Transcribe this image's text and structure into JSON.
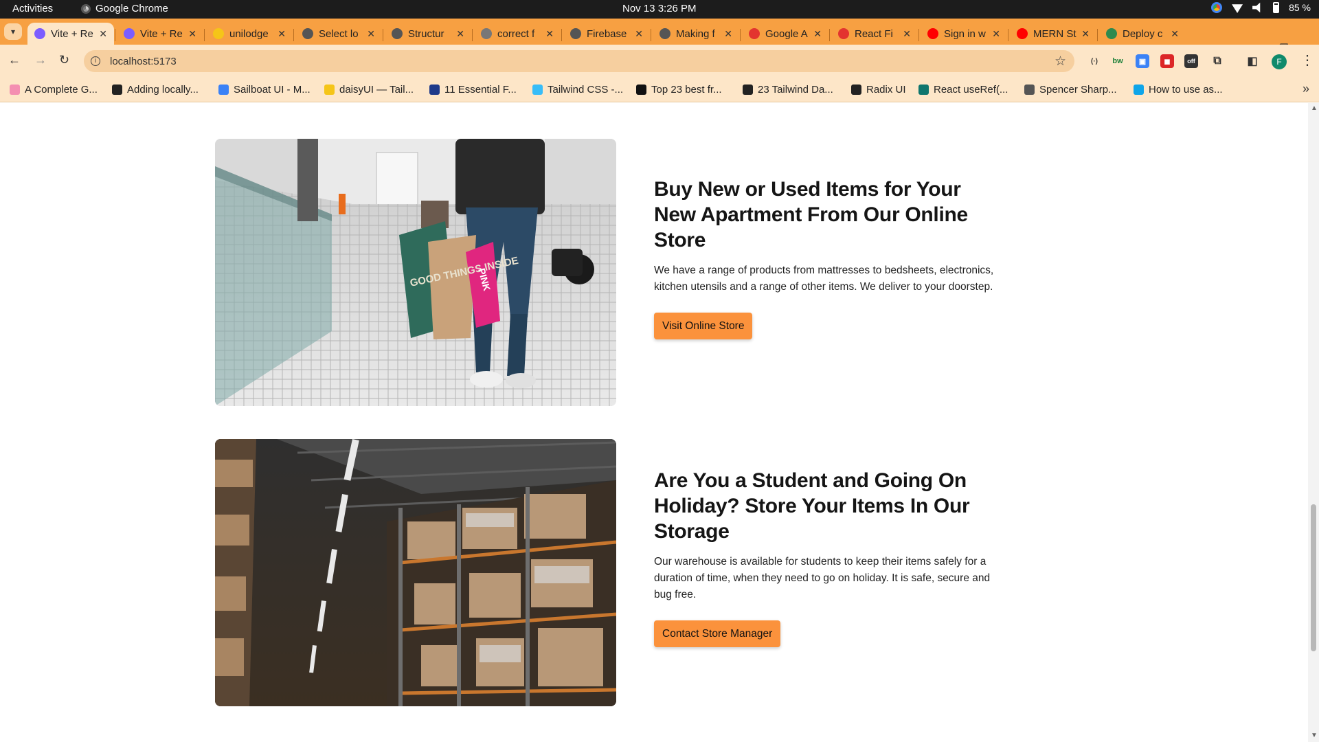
{
  "os": {
    "activities": "Activities",
    "app_name": "Google Chrome",
    "clock": "Nov 13  3:26 PM",
    "battery": "85 %"
  },
  "tabs": [
    {
      "title": "Vite + Re",
      "active": true,
      "fav_color": "#7c5cff"
    },
    {
      "title": "Vite + Re",
      "active": false,
      "fav_color": "#7c5cff"
    },
    {
      "title": "unilodge",
      "active": false,
      "fav_color": "#f5c518"
    },
    {
      "title": "Select lo",
      "active": false,
      "fav_color": "#555555"
    },
    {
      "title": "Structur",
      "active": false,
      "fav_color": "#555555"
    },
    {
      "title": "correct f",
      "active": false,
      "fav_color": "#777777"
    },
    {
      "title": "Firebase",
      "active": false,
      "fav_color": "#555555"
    },
    {
      "title": "Making f",
      "active": false,
      "fav_color": "#555555"
    },
    {
      "title": "Google A",
      "active": false,
      "fav_color": "#e3342f"
    },
    {
      "title": "React Fi",
      "active": false,
      "fav_color": "#e3342f"
    },
    {
      "title": "Sign in w",
      "active": false,
      "fav_color": "#ff0000"
    },
    {
      "title": "MERN St",
      "active": false,
      "fav_color": "#ff0000"
    },
    {
      "title": "Deploy c",
      "active": false,
      "fav_color": "#2d8a4e"
    }
  ],
  "address_bar": {
    "url": "localhost:5173"
  },
  "bookmarks": [
    {
      "label": "A Complete G...",
      "color": "#f48fb1"
    },
    {
      "label": "Adding locally...",
      "color": "#222222"
    },
    {
      "label": "Sailboat UI - M...",
      "color": "#3b82f6"
    },
    {
      "label": "daisyUI — Tail...",
      "color": "#f5c518"
    },
    {
      "label": "11 Essential F...",
      "color": "#1e3a8a"
    },
    {
      "label": "Tailwind CSS -...",
      "color": "#38bdf8"
    },
    {
      "label": "Top 23 best fr...",
      "color": "#111111"
    },
    {
      "label": "23 Tailwind Da...",
      "color": "#222222"
    },
    {
      "label": "Radix UI",
      "color": "#222222"
    },
    {
      "label": "React useRef(...",
      "color": "#0f766e"
    },
    {
      "label": "Spencer Sharp...",
      "color": "#555555"
    },
    {
      "label": "How to use as...",
      "color": "#0ea5e9"
    }
  ],
  "sections": [
    {
      "heading": "Buy New or Used Items for Your New Apartment From Our Online Store",
      "body": "We have a range of products from mattresses to bedsheets, electronics, kitchen utensils and a range of other items. We deliver to your doorstep.",
      "button": "Visit Online Store",
      "bag_text": "GOOD THINGS INSIDE",
      "pink_bag_text": "PINK"
    },
    {
      "heading": "Are You a Student and Going On Holiday? Store Your Items In Our Storage",
      "body": "Our warehouse is available for students to keep their items safely for a duration of time, when they need to go on holiday. It is safe, secure and bug free.",
      "button": "Contact Store Manager"
    }
  ],
  "colors": {
    "accent": "#fb923c",
    "tabstrip": "#f7a042",
    "toolbar": "#fde6c8"
  }
}
